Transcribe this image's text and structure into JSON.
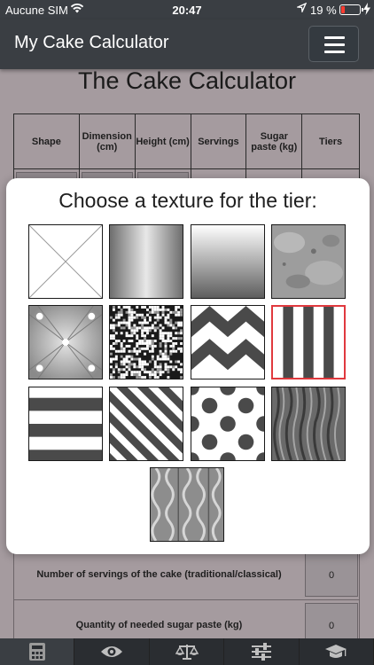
{
  "status_bar": {
    "carrier": "Aucune SIM",
    "time": "20:47",
    "battery": "19 %"
  },
  "header": {
    "title": "My Cake Calculator"
  },
  "page": {
    "heading": "The Cake Calculator",
    "table_headers": [
      "Shape",
      "Dimension (cm)",
      "Height (cm)",
      "Servings",
      "Sugar paste (kg)",
      "Tiers"
    ],
    "rows": [
      {
        "label": "Number of servings of the cake (traditional/classical)",
        "value": "0"
      },
      {
        "label": "Quantity of needed sugar paste (kg)",
        "value": "0"
      }
    ]
  },
  "modal": {
    "title": "Choose a texture for the tier:",
    "textures": [
      {
        "name": "none"
      },
      {
        "name": "vertical-gradient"
      },
      {
        "name": "horizontal-gradient"
      },
      {
        "name": "marble"
      },
      {
        "name": "quilted"
      },
      {
        "name": "noise"
      },
      {
        "name": "chevron"
      },
      {
        "name": "vertical-stripes",
        "selected": true
      },
      {
        "name": "horizontal-stripes"
      },
      {
        "name": "diagonal-stripes"
      },
      {
        "name": "polka-dots"
      },
      {
        "name": "bark"
      },
      {
        "name": "knit"
      }
    ]
  },
  "tab_bar": {
    "tabs": [
      {
        "icon": "calculator-icon",
        "active": true
      },
      {
        "icon": "eye-icon"
      },
      {
        "icon": "scale-icon"
      },
      {
        "icon": "sliders-icon"
      },
      {
        "icon": "graduation-cap-icon"
      }
    ]
  },
  "colors": {
    "header_bg": "#3a3e43",
    "page_bg": "#a59b9f",
    "selected_border": "#e0393e"
  }
}
